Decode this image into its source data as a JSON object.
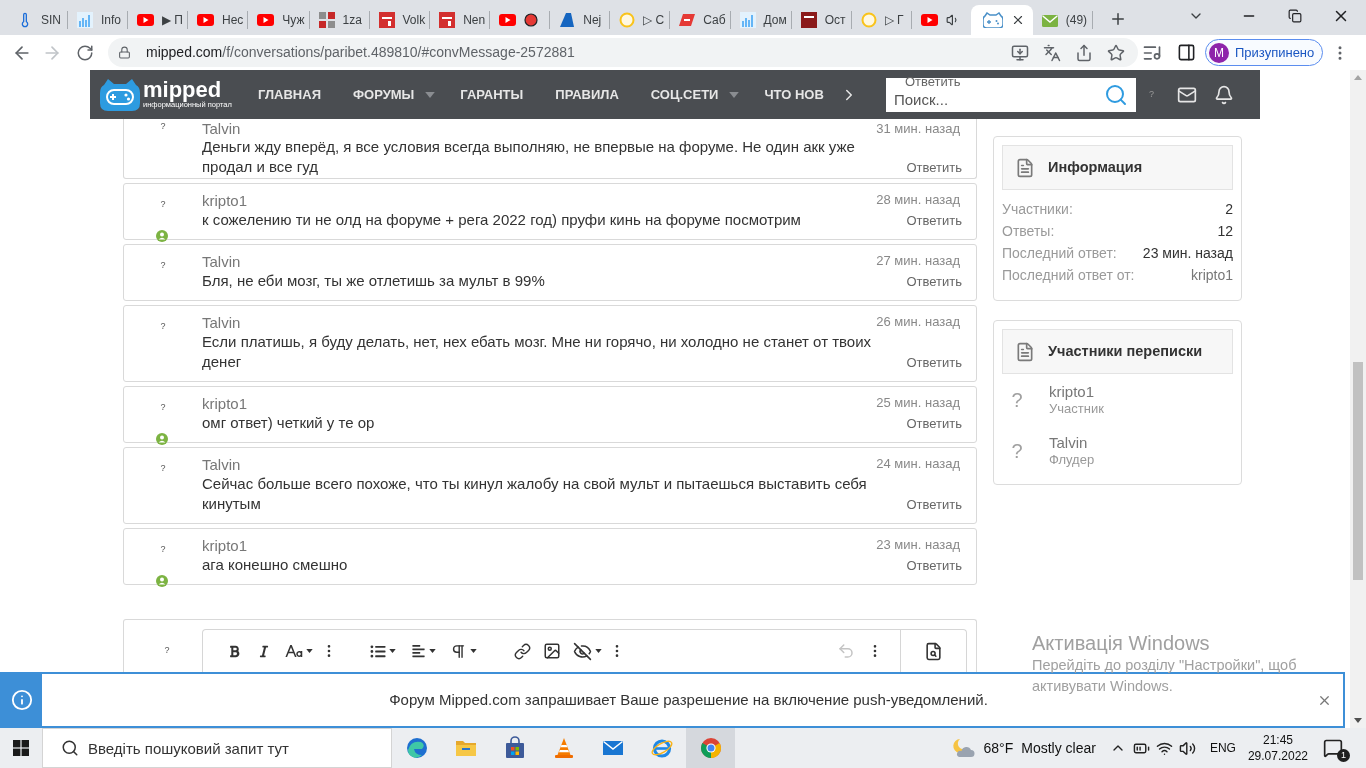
{
  "browser": {
    "tabs": [
      {
        "kind": "thermometer",
        "title": "SIN",
        "selected": false,
        "recording": false,
        "audio": false
      },
      {
        "kind": "chart",
        "title": "Info",
        "selected": false,
        "recording": false,
        "audio": false
      },
      {
        "kind": "video",
        "title": "▶ П",
        "selected": false,
        "recording": false,
        "audio": false
      },
      {
        "kind": "video",
        "title": "Нес",
        "selected": false,
        "recording": false,
        "audio": false
      },
      {
        "kind": "video",
        "title": "Чуж",
        "selected": false,
        "recording": false,
        "audio": false
      },
      {
        "kind": "tiles",
        "title": "1za",
        "selected": false,
        "recording": false,
        "audio": false
      },
      {
        "kind": "badge",
        "title": "Volk",
        "selected": false,
        "recording": false,
        "audio": false
      },
      {
        "kind": "badge",
        "title": "Nen",
        "selected": false,
        "recording": false,
        "audio": false
      },
      {
        "kind": "video",
        "selected": false,
        "recording": true,
        "audio": false
      },
      {
        "kind": "triangle",
        "title": "Nej",
        "selected": false,
        "recording": false,
        "audio": false
      },
      {
        "kind": "ring",
        "title": "▷ C",
        "selected": false,
        "recording": false,
        "audio": false
      },
      {
        "kind": "slash",
        "title": "Саб",
        "selected": false,
        "recording": false,
        "audio": false
      },
      {
        "kind": "chart",
        "title": "Дом",
        "selected": false,
        "recording": false,
        "audio": false
      },
      {
        "kind": "square",
        "title": "Ост",
        "selected": false,
        "recording": false,
        "audio": false
      },
      {
        "kind": "ring",
        "title": "▷ Г",
        "selected": false,
        "recording": false,
        "audio": false
      },
      {
        "kind": "video",
        "selected": false,
        "recording": false,
        "audio": true
      },
      {
        "kind": "gamepad",
        "selected": true,
        "recording": false,
        "audio": false
      },
      {
        "kind": "mail",
        "title": "(49)",
        "selected": false,
        "recording": false,
        "audio": false
      }
    ],
    "nav_buttons": [
      {
        "kind": "back",
        "disabled": false
      },
      {
        "kind": "forward",
        "disabled": true
      },
      {
        "kind": "reload",
        "disabled": false
      }
    ],
    "url": {
      "host": "mipped.com",
      "path": "/f/conversations/paribet.489810/#convMessage-2572881"
    },
    "profile": {
      "initial": "M",
      "status": "Призупинено"
    }
  },
  "site": {
    "logo": {
      "name": "mipped",
      "tagline": "информационный портал"
    },
    "nav": [
      {
        "label": "ГЛАВНАЯ",
        "dropdown": false
      },
      {
        "label": "ФОРУМЫ",
        "dropdown": true
      },
      {
        "label": "ГАРАНТЫ",
        "dropdown": false
      },
      {
        "label": "ПРАВИЛА",
        "dropdown": false
      },
      {
        "label": "СОЦ.СЕТИ",
        "dropdown": true
      },
      {
        "label": "ЧТО НОВ",
        "dropdown": false
      }
    ],
    "overlay_link": "Ответить",
    "search": {
      "placeholder": "Поиск..."
    },
    "user_avatar": "?"
  },
  "messages": [
    {
      "avatar": "?",
      "author": "Talvin",
      "time": "31 мин. назад",
      "text": "Деньги жду вперёд, я все условия всегда выполняю, не впервые на форуме. Не один акк уже продал и все гуд",
      "reply": "Ответить",
      "online": false
    },
    {
      "avatar": "?",
      "author": "kripto1",
      "time": "28 мин. назад",
      "text": "к сожелению ти не олд на форуме + рега 2022 год) пруфи кинь на форуме посмотрим",
      "reply": "Ответить",
      "online": true
    },
    {
      "avatar": "?",
      "author": "Talvin",
      "time": "27 мин. назад",
      "text": "Бля, не еби мозг, ты же отлетишь за мульт в 99%",
      "reply": "Ответить",
      "online": false
    },
    {
      "avatar": "?",
      "author": "Talvin",
      "time": "26 мин. назад",
      "text": "Если платишь, я буду делать, нет, нех ебать мозг. Мне ни горячо, ни холодно не станет от твоих денег",
      "reply": "Ответить",
      "online": false
    },
    {
      "avatar": "?",
      "author": "kripto1",
      "time": "25 мин. назад",
      "text": "омг ответ) четкий у те ор",
      "reply": "Ответить",
      "online": true
    },
    {
      "avatar": "?",
      "author": "Talvin",
      "time": "24 мин. назад",
      "text": "Сейчас больше всего похоже, что ты кинул жалобу на свой мульт и пытаешься выставить себя кинутым",
      "reply": "Ответить",
      "online": false
    },
    {
      "avatar": "?",
      "author": "kripto1",
      "time": "23 мин. назад",
      "text": "ага конешно смешно",
      "reply": "Ответить",
      "online": true
    }
  ],
  "sidebar": {
    "info": {
      "title": "Информация",
      "rows": [
        {
          "label": "Участники:",
          "value": "2",
          "kind": "text"
        },
        {
          "label": "Ответы:",
          "value": "12",
          "kind": "text"
        },
        {
          "label": "Последний ответ:",
          "value": "23 мин. назад",
          "kind": "text"
        },
        {
          "label": "Последний ответ от:",
          "value": "kripto1",
          "kind": "user"
        }
      ]
    },
    "participants": {
      "title": "Участники переписки",
      "members": [
        {
          "avatar": "?",
          "name": "kripto1",
          "role": "Участник"
        },
        {
          "avatar": "?",
          "name": "Talvin",
          "role": "Флудер"
        }
      ]
    }
  },
  "editor": {
    "avatar": "?",
    "toolbar": {
      "groups": [
        [
          {
            "kind": "bold",
            "dropdown": false,
            "disabled": false
          },
          {
            "kind": "italic",
            "dropdown": false,
            "disabled": false
          },
          {
            "kind": "font-size",
            "dropdown": true,
            "disabled": false
          },
          {
            "kind": "more",
            "dropdown": false,
            "disabled": false
          }
        ],
        [
          {
            "kind": "list",
            "dropdown": true,
            "disabled": false
          },
          {
            "kind": "align",
            "dropdown": true,
            "disabled": false
          },
          {
            "kind": "paragraph",
            "dropdown": true,
            "disabled": false
          }
        ],
        [
          {
            "kind": "link",
            "dropdown": false,
            "disabled": false
          },
          {
            "kind": "image",
            "dropdown": false,
            "disabled": false
          },
          {
            "kind": "hide",
            "dropdown": true,
            "disabled": false
          },
          {
            "kind": "more",
            "dropdown": false,
            "disabled": false
          }
        ]
      ],
      "right": [
        {
          "kind": "undo",
          "dropdown": false,
          "disabled": true
        },
        {
          "kind": "more",
          "dropdown": false,
          "disabled": false
        },
        {
          "kind": "preview",
          "dropdown": false,
          "disabled": false
        }
      ]
    }
  },
  "notification": {
    "text": "Форум Mipped.com запрашивает Ваше разрешение на включение push-уведомлений."
  },
  "activation_notice": {
    "title": "Активація Windows",
    "text": "Перейдіть до розділу \"Настройки\", щоб активувати Windows."
  },
  "taskbar": {
    "search": {
      "placeholder": "Введіть пошуковий запит тут"
    },
    "apps": [
      {
        "kind": "edge",
        "selected": false
      },
      {
        "kind": "explorer",
        "selected": false
      },
      {
        "kind": "store",
        "selected": false
      },
      {
        "kind": "vlc",
        "selected": false
      },
      {
        "kind": "mail",
        "selected": false
      },
      {
        "kind": "ie",
        "selected": false
      },
      {
        "kind": "chrome",
        "selected": true
      }
    ],
    "weather": {
      "temperature": "68°F",
      "condition": "Mostly clear"
    },
    "language": "ENG",
    "time": "21:45",
    "date": "29.07.2022",
    "notification_count": "1"
  }
}
